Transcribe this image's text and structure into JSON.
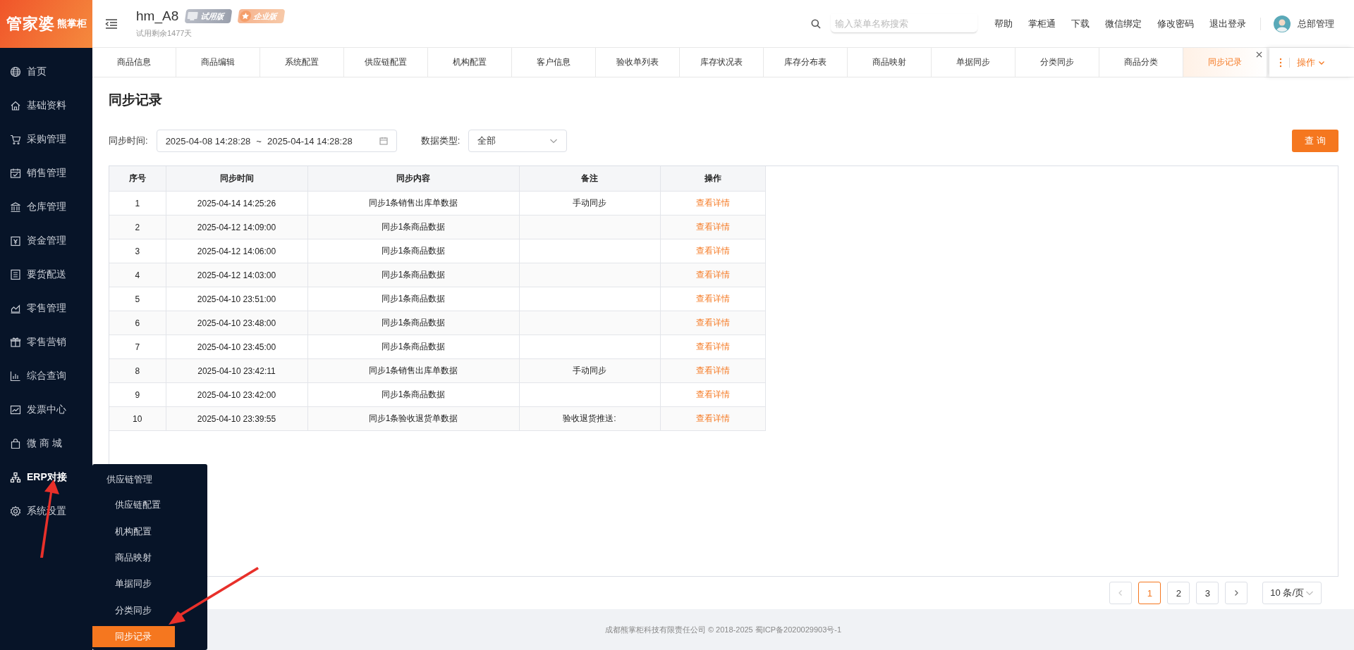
{
  "logo": {
    "brand": "管家婆",
    "product": "熊掌柜"
  },
  "header": {
    "title": "hm_A8",
    "badges": [
      {
        "label": "试用版",
        "kind": "trial"
      },
      {
        "label": "企业版",
        "kind": "enterprise"
      }
    ],
    "subtitle": "试用剩余1477天",
    "search": {
      "placeholder": "输入菜单名称搜索"
    },
    "links": [
      "帮助",
      "掌柜通",
      "下载",
      "微信绑定",
      "修改密码",
      "退出登录"
    ],
    "user": "总部管理"
  },
  "sidebar": {
    "items": [
      {
        "label": "首页",
        "selected": false
      },
      {
        "label": "基础资料",
        "selected": false
      },
      {
        "label": "采购管理",
        "selected": false
      },
      {
        "label": "销售管理",
        "selected": false
      },
      {
        "label": "仓库管理",
        "selected": false
      },
      {
        "label": "资金管理",
        "selected": false
      },
      {
        "label": "要货配送",
        "selected": false
      },
      {
        "label": "零售管理",
        "selected": false
      },
      {
        "label": "零售营销",
        "selected": false
      },
      {
        "label": "综合查询",
        "selected": false
      },
      {
        "label": "发票中心",
        "selected": false
      },
      {
        "label": "微 商 城",
        "selected": false
      },
      {
        "label": "ERP对接",
        "selected": true
      },
      {
        "label": "系统设置",
        "selected": false
      }
    ]
  },
  "submenu": {
    "title": "供应链管理",
    "items": [
      {
        "label": "供应链配置",
        "selected": false
      },
      {
        "label": "机构配置",
        "selected": false
      },
      {
        "label": "商品映射",
        "selected": false
      },
      {
        "label": "单据同步",
        "selected": false
      },
      {
        "label": "分类同步",
        "selected": false
      },
      {
        "label": "同步记录",
        "selected": true
      }
    ]
  },
  "tabs": [
    {
      "label": "商品信息",
      "selected": false
    },
    {
      "label": "商品编辑",
      "selected": false
    },
    {
      "label": "系统配置",
      "selected": false
    },
    {
      "label": "供应链配置",
      "selected": false
    },
    {
      "label": "机构配置",
      "selected": false
    },
    {
      "label": "客户信息",
      "selected": false
    },
    {
      "label": "验收单列表",
      "selected": false
    },
    {
      "label": "库存状况表",
      "selected": false
    },
    {
      "label": "库存分布表",
      "selected": false
    },
    {
      "label": "商品映射",
      "selected": false
    },
    {
      "label": "单据同步",
      "selected": false
    },
    {
      "label": "分类同步",
      "selected": false
    },
    {
      "label": "商品分类",
      "selected": false
    },
    {
      "label": "同步记录",
      "selected": true
    }
  ],
  "tab_actions": {
    "label": "操作"
  },
  "page_title": "同步记录",
  "filters": [
    {
      "kind": "daterange",
      "label": "同步时间:",
      "start": "2025-04-08 14:28:28",
      "separator": "~",
      "end": "2025-04-14 14:28:28"
    },
    {
      "kind": "select",
      "label": "数据类型:",
      "value": "全部"
    }
  ],
  "query_button": "查 询",
  "table": {
    "columns": [
      "序号",
      "同步时间",
      "同步内容",
      "备注",
      "操作"
    ],
    "rows": [
      [
        "1",
        "2025-04-14 14:25:26",
        "同步1条销售出库单数据",
        "手动同步",
        "查看详情"
      ],
      [
        "2",
        "2025-04-12 14:09:00",
        "同步1条商品数据",
        "",
        "查看详情"
      ],
      [
        "3",
        "2025-04-12 14:06:00",
        "同步1条商品数据",
        "",
        "查看详情"
      ],
      [
        "4",
        "2025-04-12 14:03:00",
        "同步1条商品数据",
        "",
        "查看详情"
      ],
      [
        "5",
        "2025-04-10 23:51:00",
        "同步1条商品数据",
        "",
        "查看详情"
      ],
      [
        "6",
        "2025-04-10 23:48:00",
        "同步1条商品数据",
        "",
        "查看详情"
      ],
      [
        "7",
        "2025-04-10 23:45:00",
        "同步1条商品数据",
        "",
        "查看详情"
      ],
      [
        "8",
        "2025-04-10 23:42:11",
        "同步1条销售出库单数据",
        "手动同步",
        "查看详情"
      ],
      [
        "9",
        "2025-04-10 23:42:00",
        "同步1条商品数据",
        "",
        "查看详情"
      ],
      [
        "10",
        "2025-04-10 23:39:55",
        "同步1条验收退货单数据",
        "验收退货推送:",
        "查看详情"
      ]
    ]
  },
  "pagination": {
    "pages": [
      {
        "label": "1",
        "selected": true
      },
      {
        "label": "2",
        "selected": false
      },
      {
        "label": "3",
        "selected": false
      }
    ],
    "page_size": "10 条/页"
  },
  "footer": "成都熊掌柜科技有限责任公司 © 2018-2025 蜀ICP备2020029903号-1"
}
